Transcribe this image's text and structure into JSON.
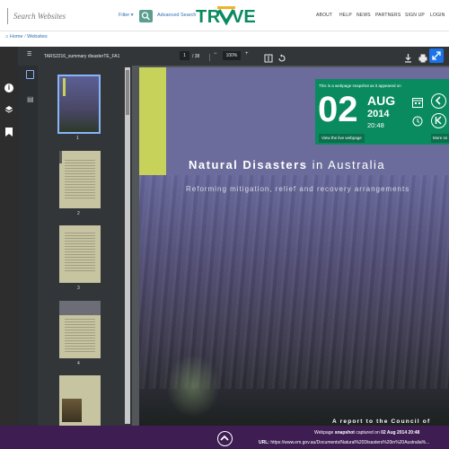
{
  "header": {
    "search_placeholder": "Search Websites",
    "filter_label": "Filter",
    "advanced_search": "Advanced Search",
    "logo_text": "TROVE",
    "nav": [
      "ABOUT",
      "HELP",
      "NEWS",
      "PARTNERS",
      "SIGN UP",
      "LOGIN"
    ]
  },
  "breadcrumb": {
    "home": "Home",
    "sep": "/",
    "current": "Websites"
  },
  "viewer": {
    "filename": "TARS2216_summary disasterTE_FA1",
    "page_current": "1",
    "page_total": "/ 38",
    "zoom": "100%",
    "minus": "−",
    "plus": "+"
  },
  "thumbnails": [
    "1",
    "2",
    "3",
    "4"
  ],
  "document": {
    "title_bold": "Natural Disasters",
    "title_rest": " in Australia",
    "subtitle": "Reforming mitigation, relief and recovery arrangements",
    "report_line": "A report to the Council of"
  },
  "snapshot": {
    "caption": "This is a webpage snapshot as it appeared on",
    "day": "02",
    "month": "AUG",
    "year": "2014",
    "time": "20:48",
    "live_button": "View the live webpage",
    "more_button": "More sn"
  },
  "footer": {
    "line1_pre": "Webpage ",
    "line1_bold": "snapshot",
    "line1_mid": " captured on ",
    "line1_date": "02 Aug 2014 20:48",
    "url_label": "URL:",
    "url": "https://www.em.gov.au/Documents/Natural%20Disasters%20in%20Australia%..."
  },
  "colors": {
    "brand_green": "#0a8a5f",
    "footer_purple": "#3d1d52",
    "accent_blue": "#2c6fb5",
    "highlight": "#1a73e8"
  }
}
